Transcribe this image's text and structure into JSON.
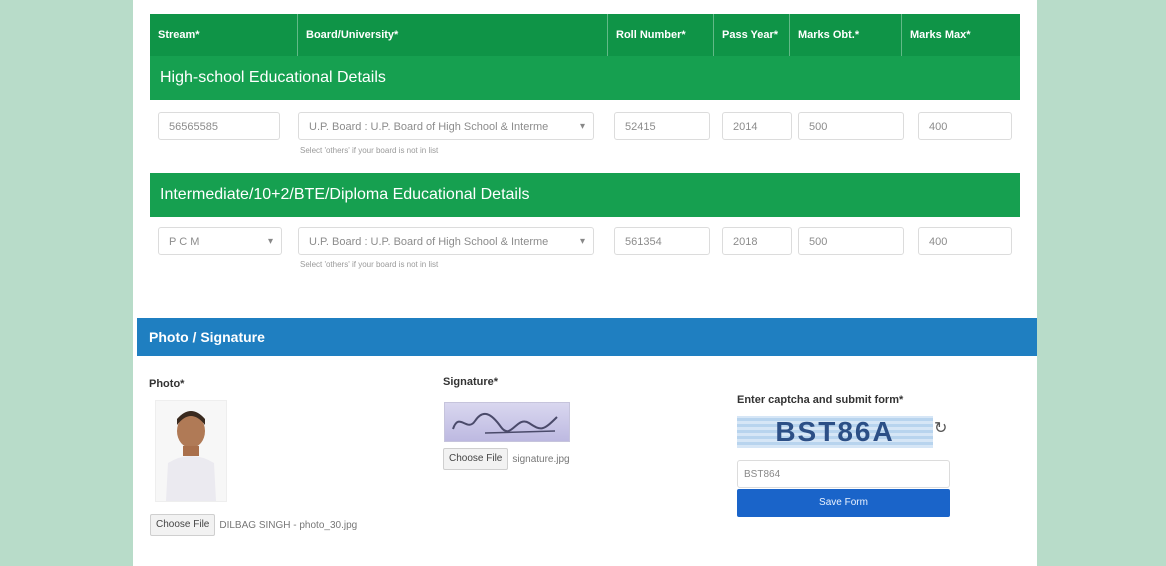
{
  "table_header": {
    "stream": "Stream*",
    "board": "Board/University*",
    "roll": "Roll Number*",
    "pass_year": "Pass Year*",
    "marks_obt": "Marks Obt.*",
    "marks_max": "Marks Max*"
  },
  "highschool": {
    "title": "High-school Educational Details",
    "stream_value": "56565585",
    "board_value": "U.P. Board : U.P. Board of High School & Interme",
    "roll_value": "52415",
    "pass_year_value": "2014",
    "marks_obt_value": "500",
    "marks_max_value": "400",
    "hint": "Select 'others' if your board is not in list"
  },
  "intermediate": {
    "title": "Intermediate/10+2/BTE/Diploma Educational Details",
    "stream_value": "P C M",
    "board_value": "U.P. Board : U.P. Board of High School & Interme",
    "roll_value": "561354",
    "pass_year_value": "2018",
    "marks_obt_value": "500",
    "marks_max_value": "400",
    "hint": "Select 'others' if your board is not in list"
  },
  "photo_section": {
    "title": "Photo / Signature",
    "photo_label": "Photo*",
    "photo_choose": "Choose File",
    "photo_file": "DILBAG SINGH - photo_30.jpg",
    "signature_label": "Signature*",
    "signature_choose": "Choose File",
    "signature_file": "signature.jpg",
    "captcha_label": "Enter captcha and submit form*",
    "captcha_text": "BST86A",
    "captcha_input_value": "BST864",
    "save_button": "Save Form"
  },
  "colors": {
    "green_header": "#0f9447",
    "blue_bar": "#1f7fc1",
    "save_button": "#1a64c9"
  }
}
